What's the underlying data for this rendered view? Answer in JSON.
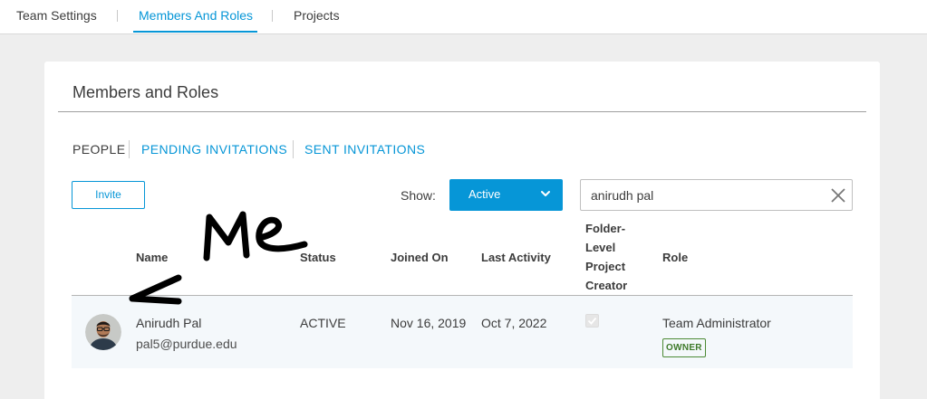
{
  "topnav": {
    "tabs": [
      {
        "label": "Team Settings",
        "active": false
      },
      {
        "label": "Members And Roles",
        "active": true
      },
      {
        "label": "Projects",
        "active": false
      }
    ]
  },
  "card": {
    "title": "Members and Roles",
    "subtabs": [
      {
        "label": "PEOPLE",
        "active": true
      },
      {
        "label": "PENDING INVITATIONS",
        "active": false
      },
      {
        "label": "SENT INVITATIONS",
        "active": false
      }
    ],
    "invite_label": "Invite",
    "show_label": "Show:",
    "show_value": "Active",
    "search_value": "anirudh pal"
  },
  "table": {
    "headers": {
      "name": "Name",
      "status": "Status",
      "joined": "Joined On",
      "last_activity": "Last Activity",
      "folder_creator": "Folder-Level Project Creator",
      "role": "Role"
    },
    "rows": [
      {
        "name": "Anirudh Pal",
        "email": "pal5@purdue.edu",
        "status": "ACTIVE",
        "joined": "Nov 16, 2019",
        "last_activity": "Oct 7, 2022",
        "folder_creator": true,
        "role": "Team Administrator",
        "badge": "OWNER"
      }
    ]
  },
  "annotation": {
    "text": "Me",
    "icon": "arrow-icon"
  },
  "colors": {
    "accent": "#0696d7",
    "owner_green": "#3e7a2a",
    "row_bg": "#f4f8fb"
  }
}
